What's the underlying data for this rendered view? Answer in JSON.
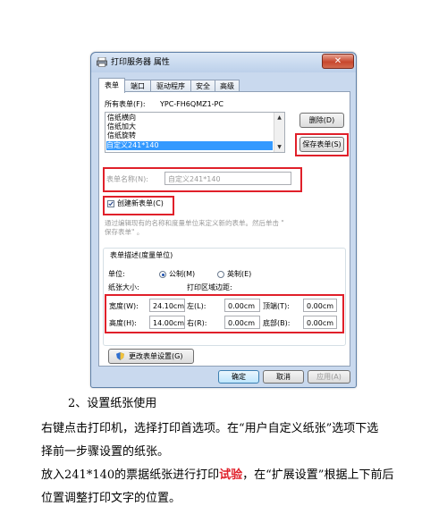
{
  "dialog": {
    "title": "打印服务器 属性",
    "close": "✕",
    "tabs": [
      {
        "label": "表单",
        "active": true
      },
      {
        "label": "端口"
      },
      {
        "label": "驱动程序"
      },
      {
        "label": "安全"
      },
      {
        "label": "高级"
      }
    ],
    "all_forms_label": "所有表单(F):",
    "server_name": "YPC-FH6QMZ1-PC",
    "forms": [
      "信纸横向",
      "信纸加大",
      "信纸旋转",
      "自定义241*140"
    ],
    "selected_form_index": 3,
    "delete_button": "删除(D)",
    "save_button": "保存表单(S)",
    "form_name_label": "表单名称(N):",
    "form_name_value": "自定义241*140",
    "create_new_form": "创建新表单(C)",
    "create_new_checked": true,
    "hint_line1": "通过编辑现有的名称和度量单位来定义新的表单。然后单击 \"",
    "hint_line2": "保存表单\" 。",
    "group_title": "表单描述(度量单位)",
    "unit_label": "单位:",
    "unit_metric": "公制(M)",
    "unit_english": "英制(E)",
    "paper_size_label": "纸张大小:",
    "margins_label": "打印区域边距:",
    "width_label": "宽度(W):",
    "width_value": "24.10cm",
    "height_label": "高度(H):",
    "height_value": "14.00cm",
    "left_label": "左(L):",
    "left_value": "0.00cm",
    "right_label": "右(R):",
    "right_value": "0.00cm",
    "top_label": "顶端(T):",
    "top_value": "0.00cm",
    "bottom_label": "底部(B):",
    "bottom_value": "0.00cm",
    "change_settings_button": "更改表单设置(G)",
    "ok_button": "确定",
    "cancel_button": "取消",
    "apply_button": "应用(A)"
  },
  "article": {
    "step": "2、设置纸张使用",
    "line1": "右键点击打印机，选择打印首选项。在“用户自定义纸张”选项下选",
    "line2": "择前一步骤设置的纸张。",
    "line3_a": "放入241*140的票据纸张进行打印",
    "line3_hl": "试验",
    "line3_b": "，在“扩展设置”根据上下前后",
    "line4": "位置调整打印文字的位置。"
  }
}
